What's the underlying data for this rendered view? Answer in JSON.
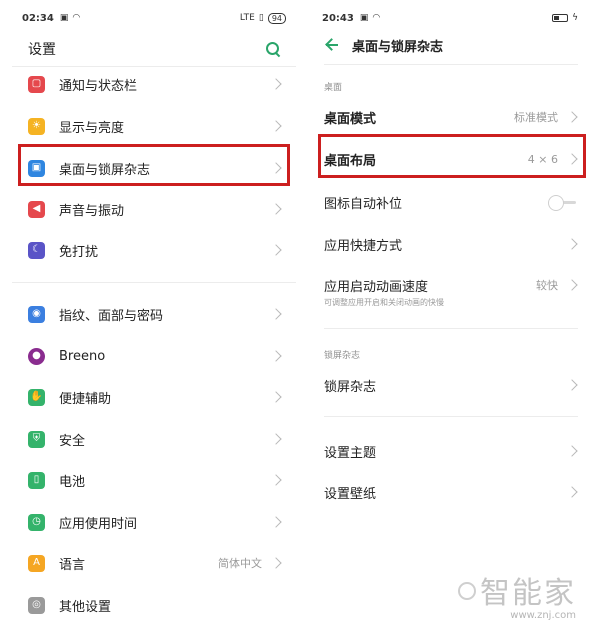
{
  "left": {
    "status": {
      "time": "02:34",
      "net": "LTE",
      "battery": "94"
    },
    "title": "设置",
    "items": [
      {
        "label": "通知与状态栏",
        "value": "",
        "color": "#e5484d",
        "glyph": "▢"
      },
      {
        "label": "显示与亮度",
        "value": "",
        "color": "#f5b323",
        "glyph": "☀"
      },
      {
        "label": "桌面与锁屏杂志",
        "value": "",
        "color": "#2f86e0",
        "glyph": "▣"
      },
      {
        "label": "声音与振动",
        "value": "",
        "color": "#e5484d",
        "glyph": "◀"
      },
      {
        "label": "免打扰",
        "value": "",
        "color": "#5a54c7",
        "glyph": "☾"
      },
      {
        "label": "指纹、面部与密码",
        "value": "",
        "color": "#3b7fe0",
        "glyph": "◉"
      },
      {
        "label": "Breeno",
        "value": "",
        "color": "#8a2c8f",
        "glyph": "●"
      },
      {
        "label": "便捷辅助",
        "value": "",
        "color": "#34b36b",
        "glyph": "✋"
      },
      {
        "label": "安全",
        "value": "",
        "color": "#34b36b",
        "glyph": "⛨"
      },
      {
        "label": "电池",
        "value": "",
        "color": "#34b36b",
        "glyph": "▯"
      },
      {
        "label": "应用使用时间",
        "value": "",
        "color": "#34b36b",
        "glyph": "◷"
      },
      {
        "label": "语言",
        "value": "简体中文",
        "color": "#f5a623",
        "glyph": "A"
      },
      {
        "label": "其他设置",
        "value": "",
        "color": "#9a9a9a",
        "glyph": "◎"
      }
    ]
  },
  "right": {
    "status": {
      "time": "20:43"
    },
    "title": "桌面与锁屏杂志",
    "section_desktop": "桌面",
    "desktop_mode": {
      "label": "桌面模式",
      "value": "标准模式"
    },
    "desktop_layout": {
      "label": "桌面布局",
      "value": "4 × 6"
    },
    "auto_fill": {
      "label": "图标自动补位"
    },
    "shortcuts": {
      "label": "应用快捷方式"
    },
    "anim_speed": {
      "label": "应用启动动画速度",
      "value": "较快",
      "sub": "可调整应用开启和关闭动画的快慢"
    },
    "section_lock": "锁屏杂志",
    "lock_magazine": {
      "label": "锁屏杂志"
    },
    "theme": {
      "label": "设置主题"
    },
    "wallpaper": {
      "label": "设置壁纸"
    }
  },
  "watermark": {
    "name": "智能家",
    "url": "www.znj.com"
  },
  "accent_color": "#2aa56a",
  "highlight_color": "#cc1f1f"
}
